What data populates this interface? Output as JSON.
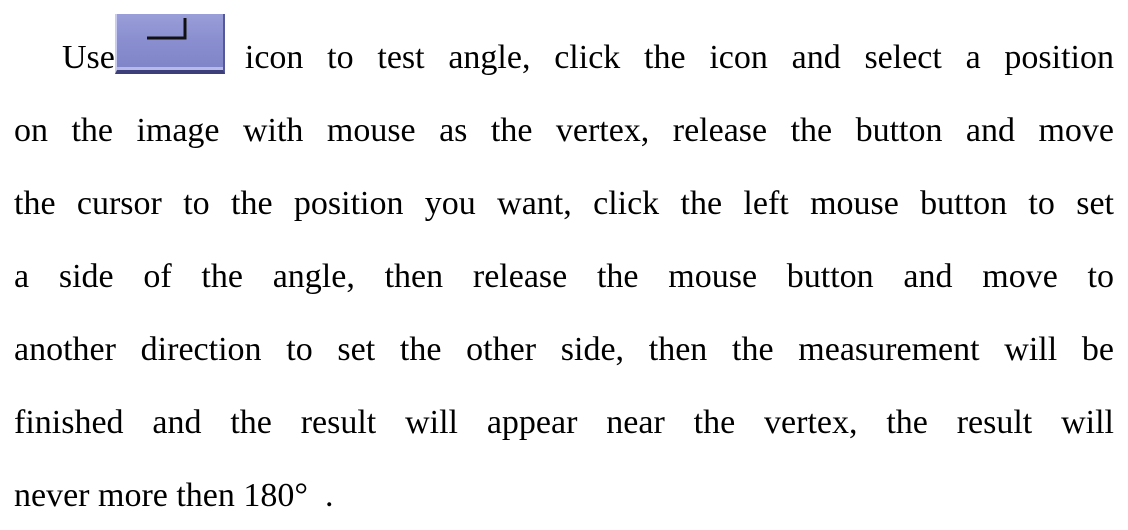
{
  "paragraph": {
    "lines": [
      "on the image with mouse as the vertex, release the button and move",
      "the cursor to the position you want, click the left mouse button to set",
      "a side of the angle, then release the mouse button and move to",
      "another direction to set the other side, then the measurement will be",
      "finished and the result will appear near the vertex, the result will",
      "never more then 180°  ."
    ],
    "first_line_before_icon": "Use",
    "first_line_after_icon": "icon to test angle, click the icon and select a position"
  },
  "icons": {
    "angle_tool": "angle-measure-icon"
  },
  "colors": {
    "icon_face": "#8a8fd0",
    "icon_shadow": "#3c3f7a",
    "text": "#000000"
  }
}
